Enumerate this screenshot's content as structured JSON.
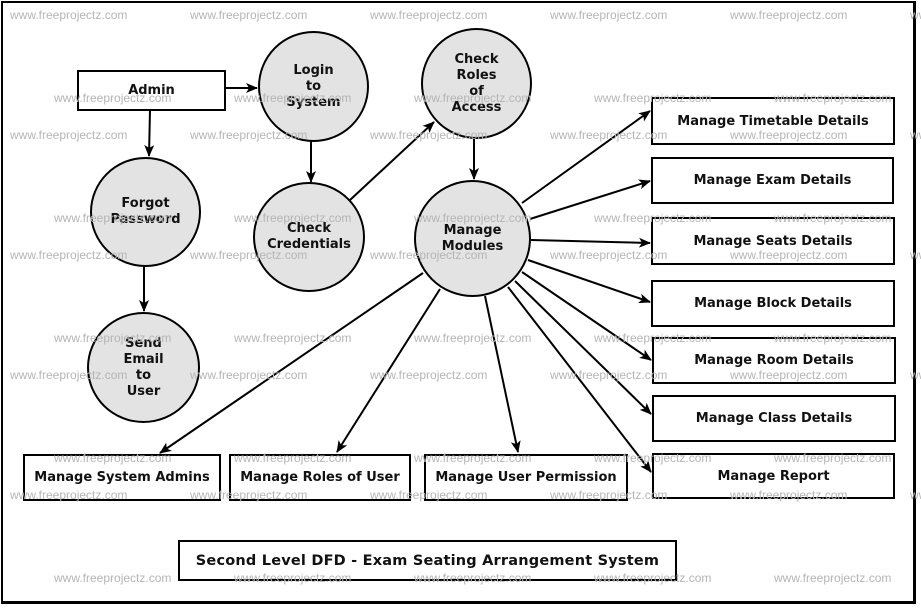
{
  "diagram": {
    "title": "Second Level DFD - Exam Seating Arrangement System",
    "watermark": "www.freeprojectz.com",
    "colors": {
      "process_fill": "#e3e3e3",
      "stroke": "#000000",
      "watermark": "#b5b5b5"
    },
    "entities": {
      "admin": "Admin",
      "manage_timetable": "Manage Timetable Details",
      "manage_exam": "Manage Exam Details",
      "manage_seats": "Manage Seats Details",
      "manage_block": "Manage Block Details",
      "manage_room": "Manage Room Details",
      "manage_class": "Manage Class Details",
      "manage_report": "Manage Report",
      "manage_system_admins": "Manage System Admins",
      "manage_roles_of_user": "Manage Roles of User",
      "manage_user_permission": "Manage User Permission"
    },
    "processes": {
      "login_to_system": "Login\nto\nSystem",
      "check_credentials": "Check\nCredentials",
      "check_roles_of_access": "Check\nRoles\nof\nAccess",
      "manage_modules": "Manage\nModules",
      "forgot_password": "Forgot\nPassword",
      "send_email_to_user": "Send\nEmail\nto\nUser"
    },
    "flows": [
      {
        "from": "Admin",
        "to": "Login to System"
      },
      {
        "from": "Admin",
        "to": "Forgot Password"
      },
      {
        "from": "Forgot Password",
        "to": "Send Email to User"
      },
      {
        "from": "Login to System",
        "to": "Check Credentials"
      },
      {
        "from": "Check Credentials",
        "to": "Check Roles of Access"
      },
      {
        "from": "Check Roles of Access",
        "to": "Manage Modules"
      },
      {
        "from": "Manage Modules",
        "to": "Manage Timetable Details"
      },
      {
        "from": "Manage Modules",
        "to": "Manage Exam Details"
      },
      {
        "from": "Manage Modules",
        "to": "Manage Seats Details"
      },
      {
        "from": "Manage Modules",
        "to": "Manage Block Details"
      },
      {
        "from": "Manage Modules",
        "to": "Manage Room Details"
      },
      {
        "from": "Manage Modules",
        "to": "Manage Class Details"
      },
      {
        "from": "Manage Modules",
        "to": "Manage Report"
      },
      {
        "from": "Manage Modules",
        "to": "Manage System Admins"
      },
      {
        "from": "Manage Modules",
        "to": "Manage Roles of User"
      },
      {
        "from": "Manage Modules",
        "to": "Manage User Permission"
      }
    ]
  }
}
